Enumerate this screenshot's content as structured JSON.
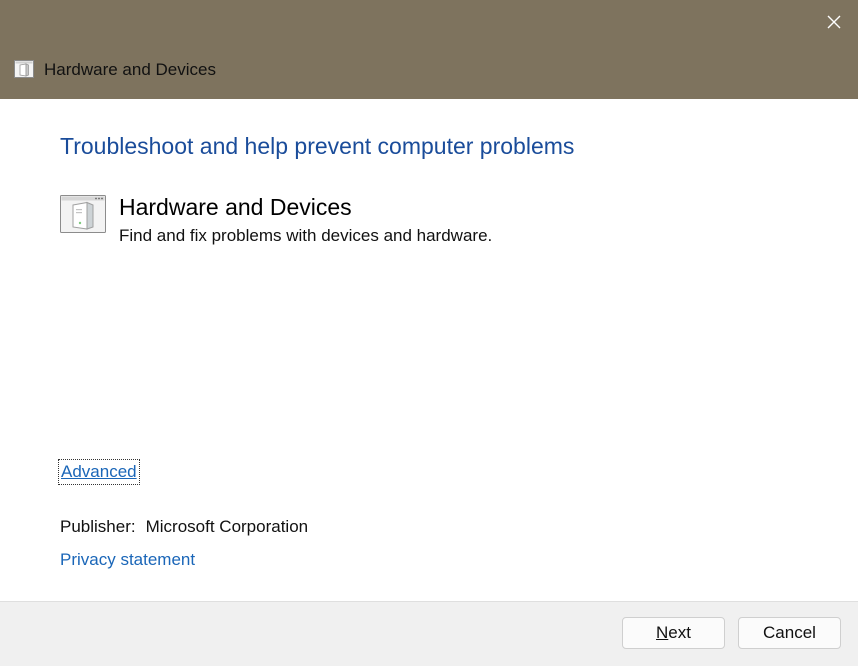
{
  "window": {
    "title": "Hardware and Devices",
    "close_icon": "close-icon",
    "app_icon": "hardware-devices-icon"
  },
  "main": {
    "heading": "Troubleshoot and help prevent computer problems",
    "troubleshooter": {
      "name": "Hardware and Devices",
      "description": "Find and fix problems with devices and hardware.",
      "icon": "hardware-devices-icon"
    },
    "advanced_link": "Advanced",
    "publisher_label": "Publisher:",
    "publisher_value": "Microsoft Corporation",
    "privacy_link": "Privacy statement"
  },
  "footer": {
    "next_label": "Next",
    "cancel_label": "Cancel"
  },
  "colors": {
    "titlebar": "#7e735e",
    "heading": "#1a4c9a",
    "link": "#1a66b8",
    "footer": "#f0f0f0"
  }
}
